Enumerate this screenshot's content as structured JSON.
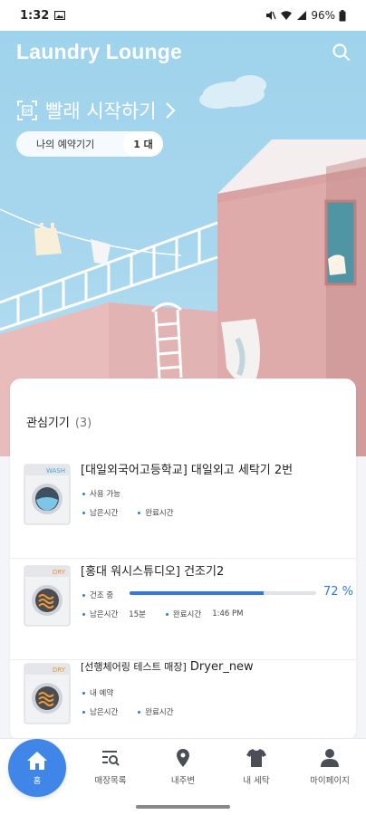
{
  "status_bar": {
    "time": "1:32",
    "battery": "96%"
  },
  "header": {
    "title": "Laundry Lounge",
    "search_icon": "search-icon"
  },
  "hero": {
    "start_wash_label": "빨래 시작하기",
    "qr_icon": "qr-scan-icon",
    "reservation_label": "나의 예약기기",
    "reservation_count": "1 대"
  },
  "favorites": {
    "title": "관심기기",
    "count": "(3)",
    "machines": [
      {
        "badge": "WASH",
        "type": "washer",
        "name": "[대일외국어고등학교] 대일외고 세탁기 2번",
        "status": "사용 가능",
        "use_time_label": "남은시간",
        "end_time_label": "완료시간"
      },
      {
        "badge": "DRY",
        "type": "dryer",
        "name": "[홍대 워시스튜디오] 건조기2",
        "status": "건조 중",
        "progress_percent": 72,
        "progress_text": "72 %",
        "use_time_label": "남은시간",
        "use_time_value": "15분",
        "end_time_label": "완료시간",
        "end_time_value": "1:46 PM"
      },
      {
        "badge": "DRY",
        "type": "dryer",
        "name_prefix": "[선행체어링 테스트 매장]",
        "name_suffix": "Dryer_new",
        "status": "내 예약",
        "use_time_label": "남은시간",
        "end_time_label": "완료시간"
      }
    ]
  },
  "bottom_nav": {
    "home": "홈",
    "items": [
      {
        "label": "매장목록",
        "icon": "store-list-icon"
      },
      {
        "label": "내주변",
        "icon": "location-pin-icon"
      },
      {
        "label": "내 세탁",
        "icon": "shirt-icon"
      },
      {
        "label": "마이페이지",
        "icon": "person-icon"
      }
    ]
  },
  "colors": {
    "accent": "#2d7be0",
    "home_button": "#3f86e8",
    "sky": "#a8d7ee",
    "building": "#e2b3b3"
  }
}
